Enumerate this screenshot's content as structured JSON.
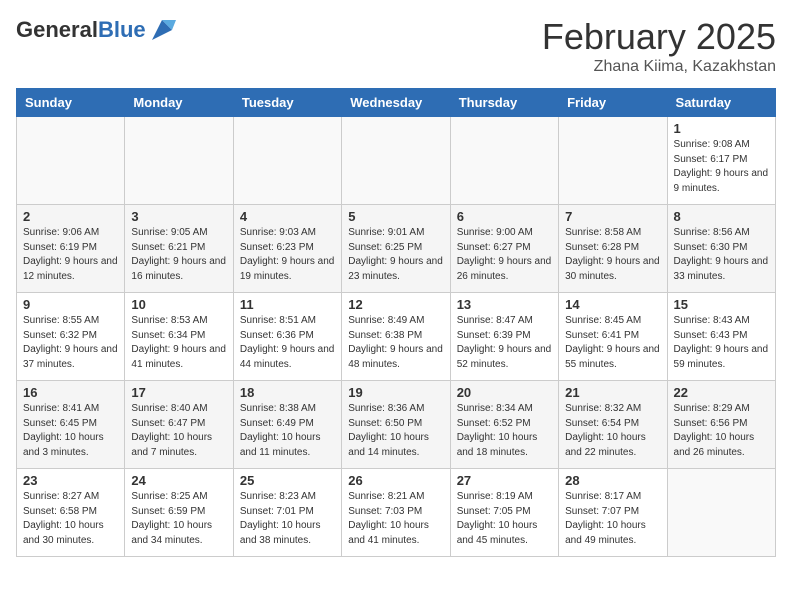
{
  "header": {
    "logo_general": "General",
    "logo_blue": "Blue",
    "month_title": "February 2025",
    "location": "Zhana Kiima, Kazakhstan"
  },
  "days_of_week": [
    "Sunday",
    "Monday",
    "Tuesday",
    "Wednesday",
    "Thursday",
    "Friday",
    "Saturday"
  ],
  "weeks": [
    [
      {
        "day": "",
        "info": ""
      },
      {
        "day": "",
        "info": ""
      },
      {
        "day": "",
        "info": ""
      },
      {
        "day": "",
        "info": ""
      },
      {
        "day": "",
        "info": ""
      },
      {
        "day": "",
        "info": ""
      },
      {
        "day": "1",
        "info": "Sunrise: 9:08 AM\nSunset: 6:17 PM\nDaylight: 9 hours and 9 minutes."
      }
    ],
    [
      {
        "day": "2",
        "info": "Sunrise: 9:06 AM\nSunset: 6:19 PM\nDaylight: 9 hours and 12 minutes."
      },
      {
        "day": "3",
        "info": "Sunrise: 9:05 AM\nSunset: 6:21 PM\nDaylight: 9 hours and 16 minutes."
      },
      {
        "day": "4",
        "info": "Sunrise: 9:03 AM\nSunset: 6:23 PM\nDaylight: 9 hours and 19 minutes."
      },
      {
        "day": "5",
        "info": "Sunrise: 9:01 AM\nSunset: 6:25 PM\nDaylight: 9 hours and 23 minutes."
      },
      {
        "day": "6",
        "info": "Sunrise: 9:00 AM\nSunset: 6:27 PM\nDaylight: 9 hours and 26 minutes."
      },
      {
        "day": "7",
        "info": "Sunrise: 8:58 AM\nSunset: 6:28 PM\nDaylight: 9 hours and 30 minutes."
      },
      {
        "day": "8",
        "info": "Sunrise: 8:56 AM\nSunset: 6:30 PM\nDaylight: 9 hours and 33 minutes."
      }
    ],
    [
      {
        "day": "9",
        "info": "Sunrise: 8:55 AM\nSunset: 6:32 PM\nDaylight: 9 hours and 37 minutes."
      },
      {
        "day": "10",
        "info": "Sunrise: 8:53 AM\nSunset: 6:34 PM\nDaylight: 9 hours and 41 minutes."
      },
      {
        "day": "11",
        "info": "Sunrise: 8:51 AM\nSunset: 6:36 PM\nDaylight: 9 hours and 44 minutes."
      },
      {
        "day": "12",
        "info": "Sunrise: 8:49 AM\nSunset: 6:38 PM\nDaylight: 9 hours and 48 minutes."
      },
      {
        "day": "13",
        "info": "Sunrise: 8:47 AM\nSunset: 6:39 PM\nDaylight: 9 hours and 52 minutes."
      },
      {
        "day": "14",
        "info": "Sunrise: 8:45 AM\nSunset: 6:41 PM\nDaylight: 9 hours and 55 minutes."
      },
      {
        "day": "15",
        "info": "Sunrise: 8:43 AM\nSunset: 6:43 PM\nDaylight: 9 hours and 59 minutes."
      }
    ],
    [
      {
        "day": "16",
        "info": "Sunrise: 8:41 AM\nSunset: 6:45 PM\nDaylight: 10 hours and 3 minutes."
      },
      {
        "day": "17",
        "info": "Sunrise: 8:40 AM\nSunset: 6:47 PM\nDaylight: 10 hours and 7 minutes."
      },
      {
        "day": "18",
        "info": "Sunrise: 8:38 AM\nSunset: 6:49 PM\nDaylight: 10 hours and 11 minutes."
      },
      {
        "day": "19",
        "info": "Sunrise: 8:36 AM\nSunset: 6:50 PM\nDaylight: 10 hours and 14 minutes."
      },
      {
        "day": "20",
        "info": "Sunrise: 8:34 AM\nSunset: 6:52 PM\nDaylight: 10 hours and 18 minutes."
      },
      {
        "day": "21",
        "info": "Sunrise: 8:32 AM\nSunset: 6:54 PM\nDaylight: 10 hours and 22 minutes."
      },
      {
        "day": "22",
        "info": "Sunrise: 8:29 AM\nSunset: 6:56 PM\nDaylight: 10 hours and 26 minutes."
      }
    ],
    [
      {
        "day": "23",
        "info": "Sunrise: 8:27 AM\nSunset: 6:58 PM\nDaylight: 10 hours and 30 minutes."
      },
      {
        "day": "24",
        "info": "Sunrise: 8:25 AM\nSunset: 6:59 PM\nDaylight: 10 hours and 34 minutes."
      },
      {
        "day": "25",
        "info": "Sunrise: 8:23 AM\nSunset: 7:01 PM\nDaylight: 10 hours and 38 minutes."
      },
      {
        "day": "26",
        "info": "Sunrise: 8:21 AM\nSunset: 7:03 PM\nDaylight: 10 hours and 41 minutes."
      },
      {
        "day": "27",
        "info": "Sunrise: 8:19 AM\nSunset: 7:05 PM\nDaylight: 10 hours and 45 minutes."
      },
      {
        "day": "28",
        "info": "Sunrise: 8:17 AM\nSunset: 7:07 PM\nDaylight: 10 hours and 49 minutes."
      },
      {
        "day": "",
        "info": ""
      }
    ]
  ]
}
